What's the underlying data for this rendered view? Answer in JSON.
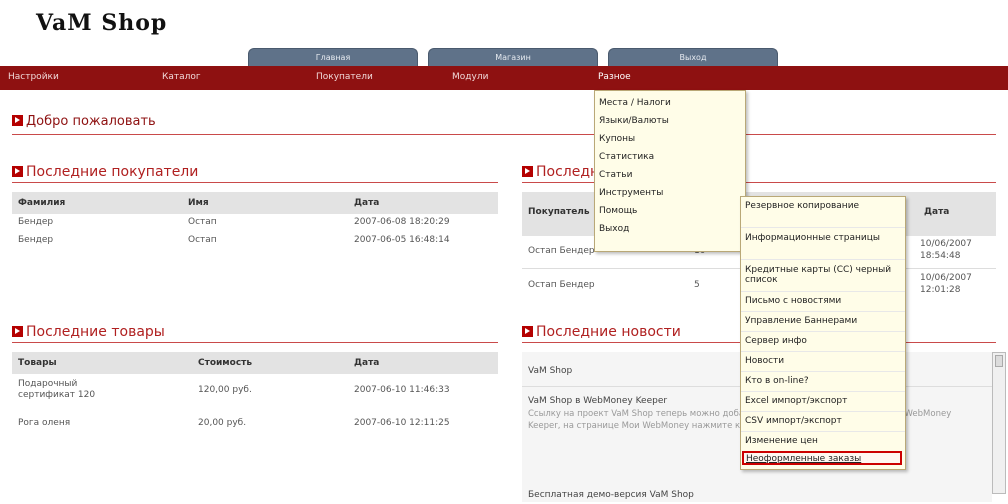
{
  "logo": "VaM Shop",
  "top_tabs": [
    "Главная",
    "Магазин",
    "Выход"
  ],
  "nav": [
    "Настройки",
    "Каталог",
    "Покупатели",
    "Модули",
    "Разное"
  ],
  "welcome": "Добро пожаловать",
  "customers": {
    "title": "Последние покупатели",
    "headers": [
      "Фамилия",
      "Имя",
      "Дата"
    ],
    "rows": [
      [
        "Бендер",
        "Остап",
        "2007-06-08 18:20:29"
      ],
      [
        "Бендер",
        "Остап",
        "2007-06-05 16:48:14"
      ]
    ]
  },
  "orders": {
    "title": "Последние заказы",
    "headers": [
      "Покупатель",
      "",
      "",
      "Дата"
    ],
    "rows": [
      [
        "Остап Бендер",
        "10",
        "10/06/2007 18:54:48"
      ],
      [
        "Остап Бендер",
        "5",
        "10/06/2007 12:01:28"
      ]
    ]
  },
  "products": {
    "title": "Последние товары",
    "headers": [
      "Товары",
      "Стоимость",
      "Дата"
    ],
    "rows": [
      [
        "Подарочный сертификат 120",
        "120,00 руб.",
        "2007-06-10 11:46:33"
      ],
      [
        "Рога оленя",
        "20,00 руб.",
        "2007-06-10 12:11:25"
      ]
    ]
  },
  "news": {
    "title": "Последние новости",
    "header": "VaM Shop",
    "item_title": "VaM Shop в WebMoney Keeper",
    "item_text": "Ссылку на проект VaM Shop теперь можно добавить в WebMoney Keeper. Откройте WebMoney Keeper, на странице Мои WebMoney нажмите кнопку... Вот так выглядит ссылка:",
    "item2_title": "Бесплатная демо-версия VaM Shop"
  },
  "misc_menu": [
    "Места / Налоги",
    "Языки/Валюты",
    "Купоны",
    "Статистика",
    "Статьи",
    "Инструменты",
    "Помощь",
    "Выход"
  ],
  "tools_menu": [
    "Резервное копирование",
    "Информационные страницы",
    "Кредитные карты (CC) черный список",
    "Письмо с новостями",
    "Управление Баннерами",
    "Сервер инфо",
    "Новости",
    "Кто в on-line?",
    "Excel импорт/экспорт",
    "CSV импорт/экспорт",
    "Изменение цен",
    "Неоформленные заказы"
  ],
  "colors": {
    "nav_bg": "#8e1111",
    "tab_bg": "#5f7289",
    "menu_bg": "#fffde8",
    "accent": "#b02020",
    "highlight_border": "#cc0000"
  }
}
